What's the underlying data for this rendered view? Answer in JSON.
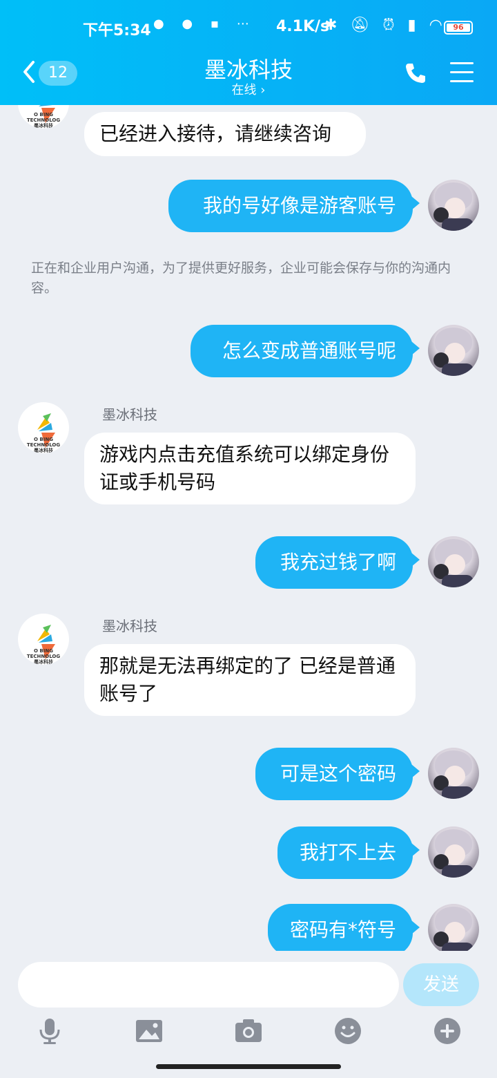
{
  "status_bar": {
    "time": "下午5:34",
    "net_speed": "4.1K/s",
    "battery": "96"
  },
  "header": {
    "unread_count": "12",
    "title": "墨冰科技",
    "subtitle": "在线 ›"
  },
  "company": {
    "name": "墨冰科技",
    "logo_caption_en": "O BING TECHNOLOG",
    "logo_caption_cn": "墨冰科技"
  },
  "messages": [
    {
      "from": "company",
      "text": "已经进入接待，请继续咨询"
    },
    {
      "from": "user",
      "text": "我的号好像是游客账号"
    },
    {
      "from": "user",
      "text": "怎么变成普通账号呢"
    },
    {
      "from": "company",
      "text": "游戏内点击充值系统可以绑定身份证或手机号码"
    },
    {
      "from": "user",
      "text": "我充过钱了啊"
    },
    {
      "from": "company",
      "text": "那就是无法再绑定的了 已经是普通账号了"
    },
    {
      "from": "user",
      "text": "可是这个密码"
    },
    {
      "from": "user",
      "text": "我打不上去"
    },
    {
      "from": "user",
      "text": "密码有*符号"
    }
  ],
  "notice": "正在和企业用户沟通，为了提供更好服务，企业可能会保存与你的沟通内容。",
  "composer": {
    "placeholder": "",
    "send_label": "发送"
  },
  "toolbar": {
    "icons": [
      "microphone-icon",
      "image-icon",
      "camera-icon",
      "emoji-icon",
      "plus-icon"
    ]
  },
  "colors": {
    "header": "#0aa8f5",
    "outgoing_bubble": "#1fb4f5",
    "incoming_bubble": "#ffffff",
    "background": "#eceff4",
    "send_disabled": "#b4e6fb"
  }
}
